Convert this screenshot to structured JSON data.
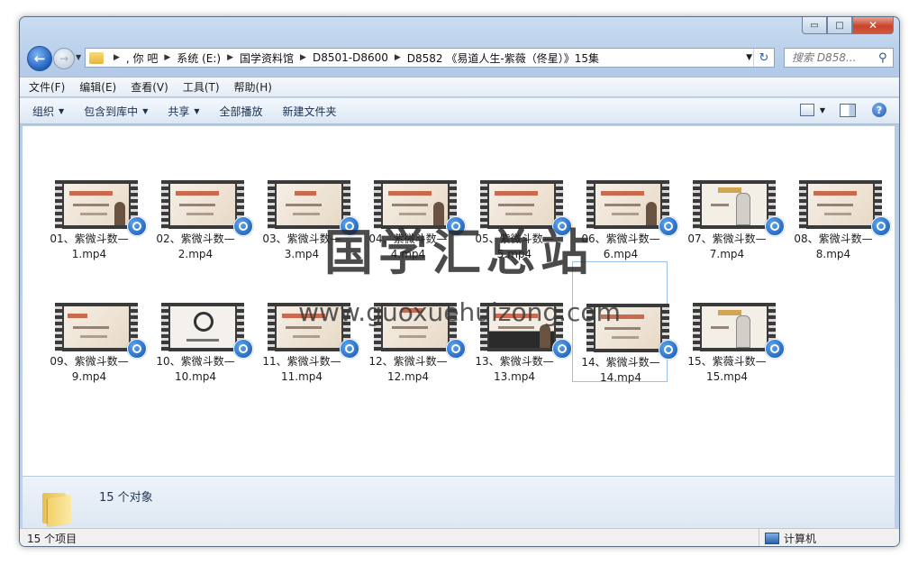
{
  "window": {
    "controls": {
      "minimize": "▭",
      "maximize": "□",
      "close": "✕"
    }
  },
  "nav": {
    "back": "←",
    "forward": "→",
    "recent": "▼"
  },
  "address": {
    "crumbs": [
      ", 你  吧",
      "系统 (E:)",
      "国学资料馆",
      "D8501-D8600",
      "D8582 《易道人生-紫薇（佟星）》15集"
    ],
    "dropdown": "▼",
    "refresh": "↻"
  },
  "search": {
    "placeholder": "搜索 D858...",
    "icon": "search-icon"
  },
  "menu": [
    "文件(F)",
    "编辑(E)",
    "查看(V)",
    "工具(T)",
    "帮助(H)"
  ],
  "toolbar": {
    "organize": "组织",
    "include": "包含到库中",
    "share": "共享",
    "play_all": "全部播放",
    "new_folder": "新建文件夹",
    "help": "?"
  },
  "files": [
    {
      "line1": "01、紫微斗数—",
      "line2": "1.mp4"
    },
    {
      "line1": "02、紫微斗数—",
      "line2": "2.mp4"
    },
    {
      "line1": "03、紫微斗数—",
      "line2": "3.mp4"
    },
    {
      "line1": "04、紫微斗数—",
      "line2": "4.mp4"
    },
    {
      "line1": "05、紫微斗数—",
      "line2": "5.mp4"
    },
    {
      "line1": "06、紫微斗数—",
      "line2": "6.mp4"
    },
    {
      "line1": "07、紫微斗数—",
      "line2": "7.mp4"
    },
    {
      "line1": "08、紫微斗数—",
      "line2": "8.mp4"
    },
    {
      "line1": "09、紫微斗数—",
      "line2": "9.mp4"
    },
    {
      "line1": "10、紫微斗数—",
      "line2": "10.mp4"
    },
    {
      "line1": "11、紫微斗数—",
      "line2": "11.mp4"
    },
    {
      "line1": "12、紫微斗数—",
      "line2": "12.mp4"
    },
    {
      "line1": "13、紫微斗数—",
      "line2": "13.mp4"
    },
    {
      "line1": "14、紫微斗数—",
      "line2": "14.mp4"
    },
    {
      "line1": "15、紫薇斗数—",
      "line2": "15.mp4"
    }
  ],
  "details": {
    "count": "15 个对象"
  },
  "status": {
    "items": "15 个项目",
    "location": "计算机"
  },
  "watermark": {
    "cn": "国学汇总站",
    "url": "www.guoxuehuizong.com"
  }
}
